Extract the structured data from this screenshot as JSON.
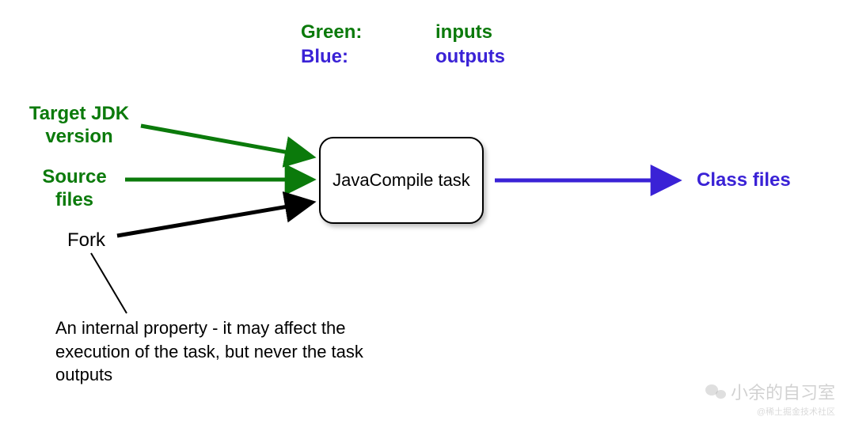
{
  "legend": {
    "green_label": "Green:",
    "green_value": "inputs",
    "blue_label": "Blue:",
    "blue_value": "outputs"
  },
  "inputs": {
    "target_jdk": "Target JDK version",
    "source_files": "Source files",
    "fork": "Fork"
  },
  "task": {
    "label": "JavaCompile task"
  },
  "outputs": {
    "class_files": "Class files"
  },
  "note": "An internal property - it may affect the execution of the task, but never the task outputs",
  "watermark": {
    "main": "小余的自习室",
    "sub": "@稀土掘金技术社区"
  },
  "colors": {
    "green": "#0b7a0b",
    "blue": "#3a22d6",
    "black": "#000000"
  }
}
